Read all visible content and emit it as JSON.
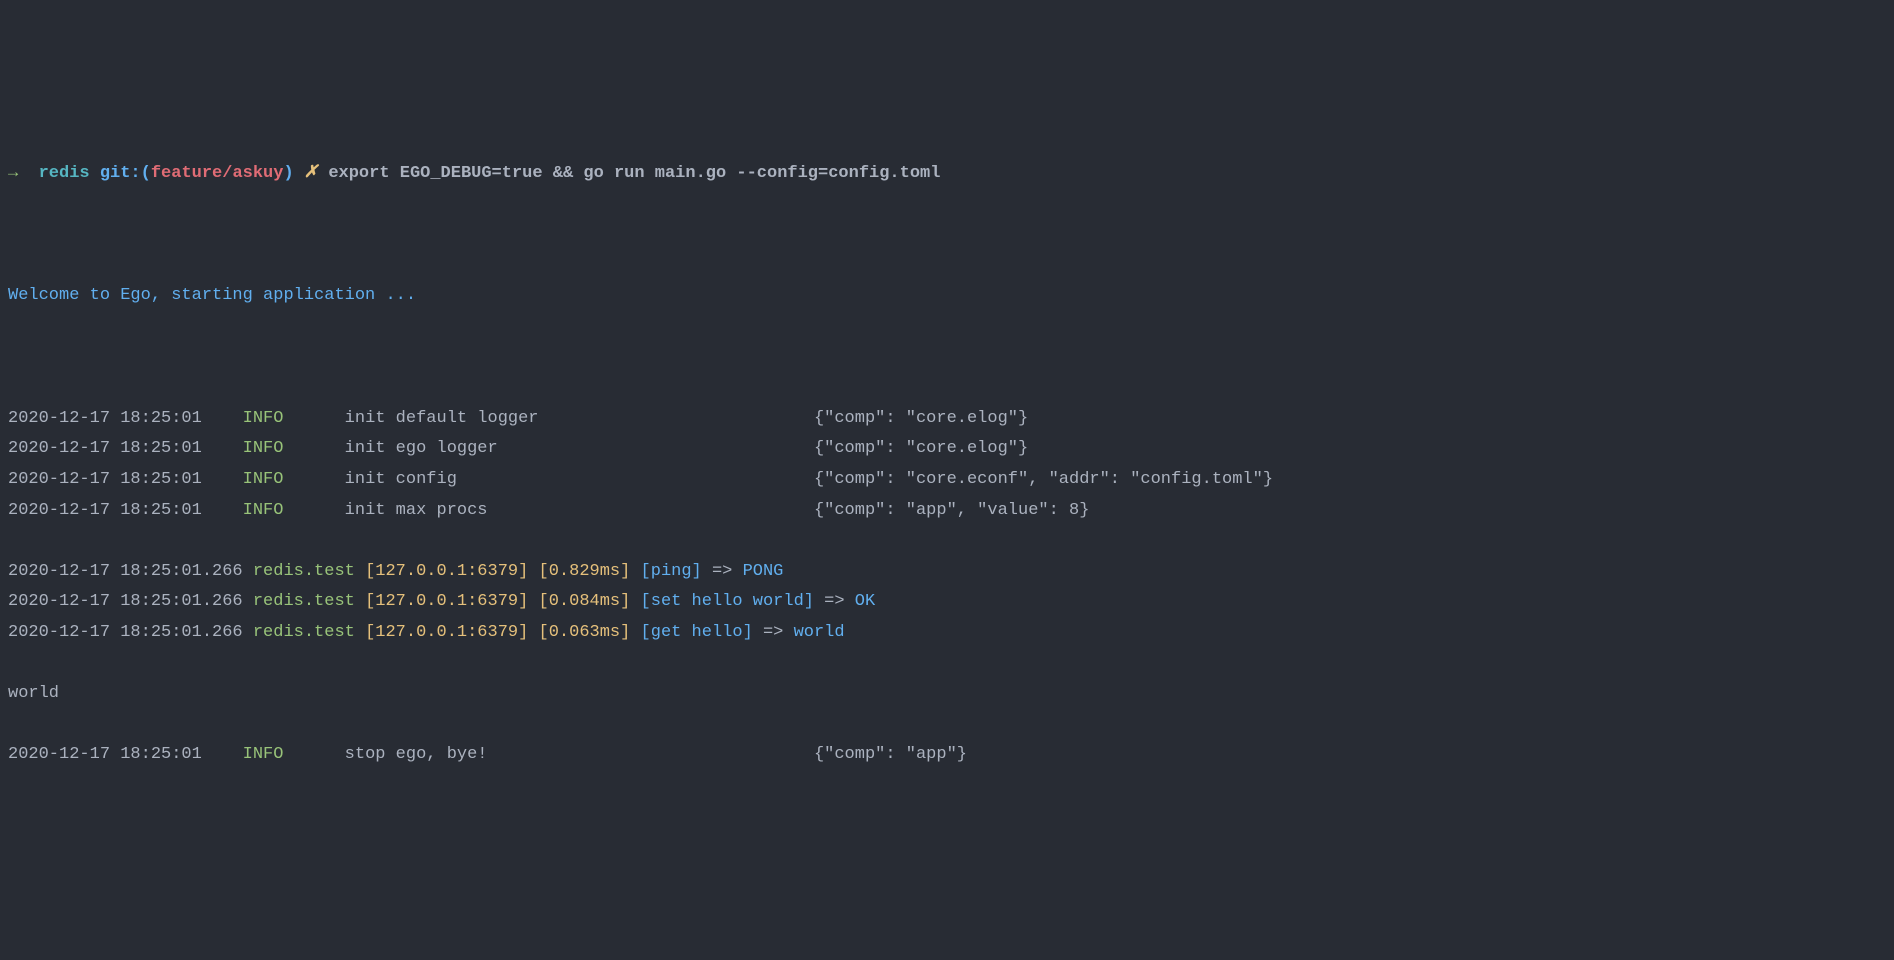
{
  "prompt": {
    "arrow": "→",
    "repo": "redis",
    "git_label": "git:",
    "paren_open": "(",
    "branch": "feature/askuy",
    "paren_close": ")",
    "dirty": "✗",
    "command": "export EGO_DEBUG=true && go run main.go --config=config.toml"
  },
  "welcome": "Welcome to Ego, starting application ...",
  "info_lines": [
    {
      "ts": "2020-12-17 18:25:01",
      "level": "INFO",
      "msg": "init default logger",
      "meta": "{\"comp\": \"core.elog\"}"
    },
    {
      "ts": "2020-12-17 18:25:01",
      "level": "INFO",
      "msg": "init ego logger",
      "meta": "{\"comp\": \"core.elog\"}"
    },
    {
      "ts": "2020-12-17 18:25:01",
      "level": "INFO",
      "msg": "init config",
      "meta": "{\"comp\": \"core.econf\", \"addr\": \"config.toml\"}"
    },
    {
      "ts": "2020-12-17 18:25:01",
      "level": "INFO",
      "msg": "init max procs",
      "meta": "{\"comp\": \"app\", \"value\": 8}"
    }
  ],
  "redis_lines": [
    {
      "ts": "2020-12-17 18:25:01.266",
      "name": "redis.test",
      "addr": "[127.0.0.1:6379]",
      "dur": "[0.829ms]",
      "op": "[ping]",
      "arrow": " => ",
      "result": "PONG"
    },
    {
      "ts": "2020-12-17 18:25:01.266",
      "name": "redis.test",
      "addr": "[127.0.0.1:6379]",
      "dur": "[0.084ms]",
      "op": "[set hello world]",
      "arrow": " => ",
      "result": "OK"
    },
    {
      "ts": "2020-12-17 18:25:01.266",
      "name": "redis.test",
      "addr": "[127.0.0.1:6379]",
      "dur": "[0.063ms]",
      "op": "[get hello]",
      "arrow": " => ",
      "result": "world"
    }
  ],
  "plain_output": "world",
  "stop_line": {
    "ts": "2020-12-17 18:25:01",
    "level": "INFO",
    "msg": "stop ego, bye!",
    "meta": "{\"comp\": \"app\"}"
  },
  "layout": {
    "level_col": 23,
    "msg_col": 33,
    "meta_col": 79
  }
}
